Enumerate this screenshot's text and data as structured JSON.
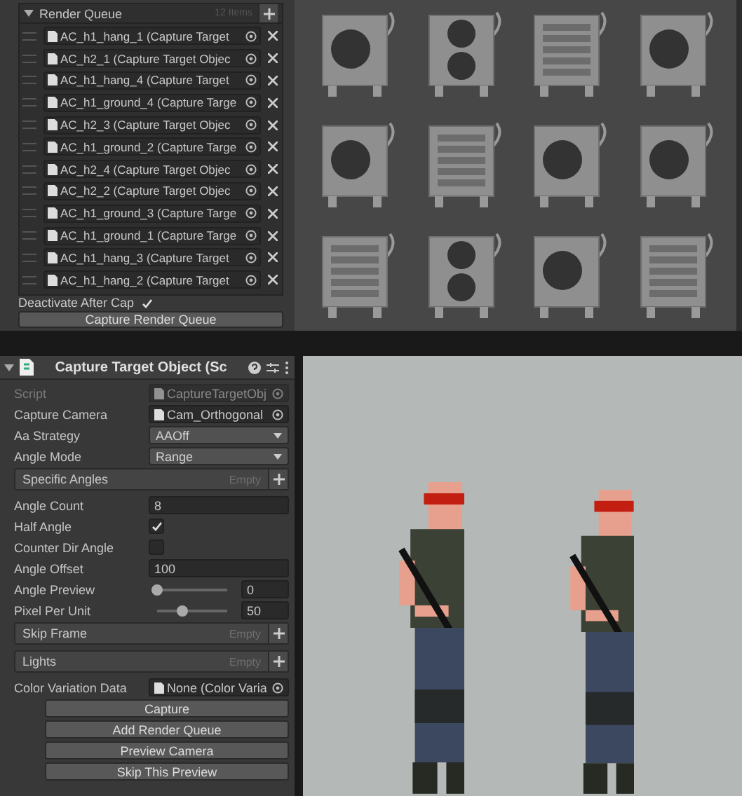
{
  "render_queue": {
    "title": "Render Queue",
    "count": "12 Items",
    "expanded": true,
    "items": [
      {
        "label": "AC_h1_hang_1 (Capture Target"
      },
      {
        "label": "AC_h2_1 (Capture Target Objec"
      },
      {
        "label": "AC_h1_hang_4 (Capture Target"
      },
      {
        "label": "AC_h1_ground_4 (Capture Targe"
      },
      {
        "label": "AC_h2_3 (Capture Target Objec"
      },
      {
        "label": "AC_h1_ground_2 (Capture Targe"
      },
      {
        "label": "AC_h2_4 (Capture Target Objec"
      },
      {
        "label": "AC_h2_2 (Capture Target Objec"
      },
      {
        "label": "AC_h1_ground_3 (Capture Targe"
      },
      {
        "label": "AC_h1_ground_1 (Capture Targe"
      },
      {
        "label": "AC_h1_hang_3 (Capture Target"
      },
      {
        "label": "AC_h1_hang_2 (Capture Target"
      }
    ],
    "deactivate": {
      "label": "Deactivate After Cap",
      "checked": true
    },
    "button": "Capture Render Queue"
  },
  "inspector": {
    "title": "Capture Target Object (Sc",
    "expanded": true,
    "fields": [
      {
        "kind": "object",
        "label": "Script",
        "value": "CaptureTargetObj",
        "disabled": true
      },
      {
        "kind": "object",
        "label": "Capture Camera",
        "value": "Cam_Orthogonal",
        "disabled": false
      },
      {
        "kind": "dropdown",
        "label": "Aa Strategy",
        "value": "AAOff"
      },
      {
        "kind": "dropdown",
        "label": "Angle Mode",
        "value": "Range"
      },
      {
        "kind": "list",
        "label": "Specific Angles",
        "value": "Empty"
      },
      {
        "kind": "text",
        "label": "Angle Count",
        "value": "8"
      },
      {
        "kind": "checkbox",
        "label": "Half Angle",
        "checked": true
      },
      {
        "kind": "checkbox",
        "label": "Counter Dir Angle",
        "checked": false
      },
      {
        "kind": "text",
        "label": "Angle Offset",
        "value": "100"
      },
      {
        "kind": "slider",
        "label": "Angle Preview",
        "level": 0,
        "value": "0"
      },
      {
        "kind": "slider",
        "label": "Pixel Per Unit",
        "level": 0.35,
        "value": "50"
      },
      {
        "kind": "list",
        "label": "Skip Frame",
        "value": "Empty"
      },
      {
        "kind": "list",
        "label": "Lights",
        "value": "Empty"
      },
      {
        "kind": "object",
        "label": "Color Variation Data",
        "value": "None (Color Varia",
        "disabled": false
      }
    ],
    "buttons": [
      "Capture",
      "Add Render Queue",
      "Preview Camera",
      "Skip This Preview"
    ]
  }
}
